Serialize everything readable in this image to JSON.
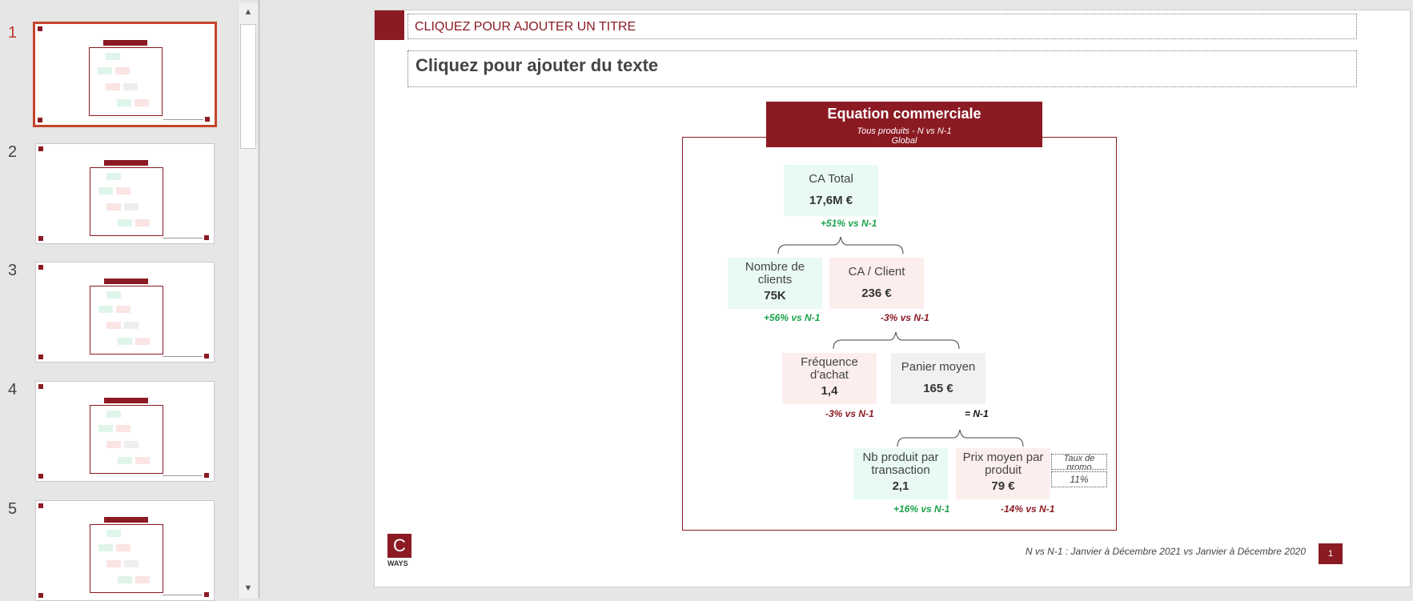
{
  "thumbnails": [
    {
      "num": "1",
      "active": true
    },
    {
      "num": "2",
      "active": false
    },
    {
      "num": "3",
      "active": false
    },
    {
      "num": "4",
      "active": false
    },
    {
      "num": "5",
      "active": false
    }
  ],
  "scrollbar": {
    "up_arrow": "▲",
    "down_arrow": "▼"
  },
  "slide": {
    "title_placeholder": "CLIQUEZ POUR AJOUTER UN TITRE",
    "text_placeholder": "Cliquez pour ajouter du texte",
    "equation": {
      "header": "Equation commerciale",
      "subtitle": "Tous produits - N vs N-1",
      "scope": "Global"
    },
    "nodes": {
      "ca_total": {
        "label": "CA Total",
        "value": "17,6M €",
        "delta": "+51% vs N-1",
        "color": "#e8faf3"
      },
      "nb_clients": {
        "label": "Nombre de clients",
        "value": "75K",
        "delta": "+56% vs N-1",
        "color": "#e8faf3"
      },
      "ca_client": {
        "label": "CA / Client",
        "value": "236 €",
        "delta": "-3% vs N-1",
        "color": "#fdeeee"
      },
      "frequence": {
        "label": "Fréquence d'achat",
        "value": "1,4",
        "delta": "-3% vs N-1",
        "color": "#fdeeee"
      },
      "panier": {
        "label": "Panier moyen",
        "value": "165 €",
        "delta": "= N-1",
        "color": "#f1f1f1"
      },
      "nb_produit": {
        "label": "Nb produit par transaction",
        "value": "2,1",
        "delta": "+16% vs N-1",
        "color": "#e8faf3"
      },
      "prix_moyen": {
        "label": "Prix moyen par produit",
        "value": "79 €",
        "delta": "-14% vs N-1",
        "color": "#fdeeee"
      }
    },
    "promo": {
      "label": "Taux de promo",
      "value": "11%"
    },
    "footnote": "N vs N-1 : Janvier à Décembre 2021 vs Janvier à Décembre 2020",
    "page_number": "1",
    "logo": {
      "letter": "C",
      "text": "WAYS"
    }
  },
  "colors": {
    "brand": "#8b1a23",
    "green": "#1aa34a",
    "selected_thumb_border": "#c4442c"
  }
}
